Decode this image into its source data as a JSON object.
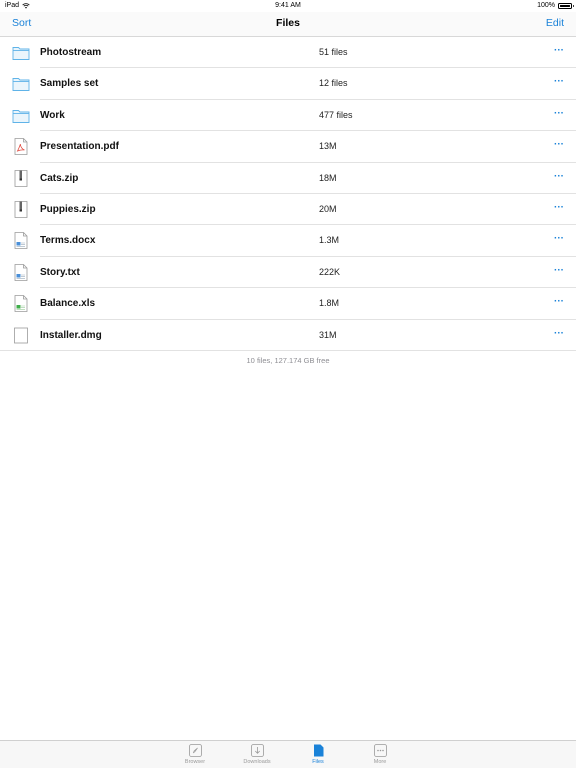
{
  "status_bar": {
    "device": "iPad",
    "time": "9:41 AM",
    "battery": "100%"
  },
  "nav": {
    "left_label": "Sort",
    "title": "Files",
    "right_label": "Edit"
  },
  "files": [
    {
      "name": "Photostream",
      "size": "51 files",
      "icon": "folder-icon"
    },
    {
      "name": "Samples set",
      "size": "12 files",
      "icon": "folder-icon"
    },
    {
      "name": "Work",
      "size": "477 files",
      "icon": "folder-icon"
    },
    {
      "name": "Presentation.pdf",
      "size": "13M",
      "icon": "pdf-file-icon"
    },
    {
      "name": "Cats.zip",
      "size": "18M",
      "icon": "zip-file-icon"
    },
    {
      "name": "Puppies.zip",
      "size": "20M",
      "icon": "zip-file-icon"
    },
    {
      "name": "Terms.docx",
      "size": "1.3M",
      "icon": "doc-file-icon"
    },
    {
      "name": "Story.txt",
      "size": "222K",
      "icon": "text-file-icon"
    },
    {
      "name": "Balance.xls",
      "size": "1.8M",
      "icon": "spreadsheet-file-icon"
    },
    {
      "name": "Installer.dmg",
      "size": "31M",
      "icon": "blank-file-icon"
    }
  ],
  "more_glyph": "···",
  "summary": "10 files, 127.174 GB free",
  "tabs": [
    {
      "label": "Browser",
      "icon": "compass-icon",
      "active": false
    },
    {
      "label": "Downloads",
      "icon": "download-icon",
      "active": false
    },
    {
      "label": "Files",
      "icon": "files-icon",
      "active": true
    },
    {
      "label": "More",
      "icon": "more-icon",
      "active": false
    }
  ],
  "colors": {
    "accent": "#1a82d8",
    "folder": "#5fb3e8",
    "pdf": "#e04a3f",
    "doc": "#4a8fd8",
    "xls": "#3fae4a",
    "separator": "#e2e2e2",
    "muted": "#8e8e93"
  }
}
